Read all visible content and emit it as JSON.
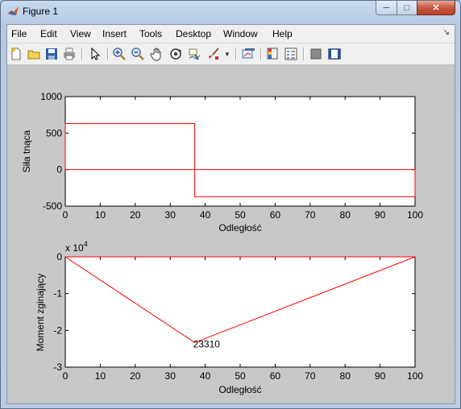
{
  "window": {
    "title": "Figure 1",
    "minimize_icon": "minimize-icon",
    "maximize_icon": "maximize-icon",
    "close_icon": "close-icon"
  },
  "menu": [
    {
      "label": "File"
    },
    {
      "label": "Edit"
    },
    {
      "label": "View"
    },
    {
      "label": "Insert"
    },
    {
      "label": "Tools"
    },
    {
      "label": "Desktop"
    },
    {
      "label": "Window"
    },
    {
      "label": "Help"
    }
  ],
  "toolbar": {
    "icons": [
      "new-figure-icon",
      "open-file-icon",
      "save-icon",
      "print-icon",
      "edit-plot-arrow-icon",
      "zoom-in-icon",
      "zoom-out-icon",
      "pan-hand-icon",
      "rotate-3d-icon",
      "data-cursor-icon",
      "brush-icon",
      "brush-dropdown-icon",
      "link-plot-icon",
      "colorbar-icon",
      "legend-icon",
      "hide-plot-tools-icon",
      "show-plot-tools-icon"
    ]
  },
  "colors": {
    "line": "#ff0000",
    "axes_bg": "#ffffff",
    "figure_bg": "#c8c8c8"
  },
  "chart_data": [
    {
      "type": "line",
      "xlabel": "Odległość",
      "ylabel": "Siła tnąca",
      "xlim": [
        0,
        100
      ],
      "ylim": [
        -500,
        1000
      ],
      "xticks": [
        "0",
        "10",
        "20",
        "30",
        "40",
        "50",
        "60",
        "70",
        "80",
        "90",
        "100"
      ],
      "yticks": [
        "-500",
        "0",
        "500",
        "1000"
      ],
      "series": [
        {
          "x": [
            0,
            0,
            37,
            37,
            100,
            100
          ],
          "y": [
            0,
            630,
            630,
            -370,
            -370,
            0
          ]
        },
        {
          "x": [
            0,
            100
          ],
          "y": [
            0,
            0
          ]
        }
      ]
    },
    {
      "type": "line",
      "xlabel": "Odległość",
      "ylabel": "Moment zginający",
      "xlim": [
        0,
        100
      ],
      "ylim": [
        -3,
        0
      ],
      "scale_label": "x 10",
      "scale_exponent": "4",
      "xticks": [
        "0",
        "10",
        "20",
        "30",
        "40",
        "50",
        "60",
        "70",
        "80",
        "90",
        "100"
      ],
      "yticks": [
        "-3",
        "-2",
        "-1",
        "0"
      ],
      "series": [
        {
          "x": [
            0,
            37,
            100
          ],
          "y": [
            0,
            -2.331,
            0
          ]
        },
        {
          "x": [
            0,
            100
          ],
          "y": [
            0,
            0
          ]
        }
      ],
      "annotations": [
        {
          "text": "23310",
          "x": 37,
          "y": -2.331
        }
      ]
    }
  ]
}
